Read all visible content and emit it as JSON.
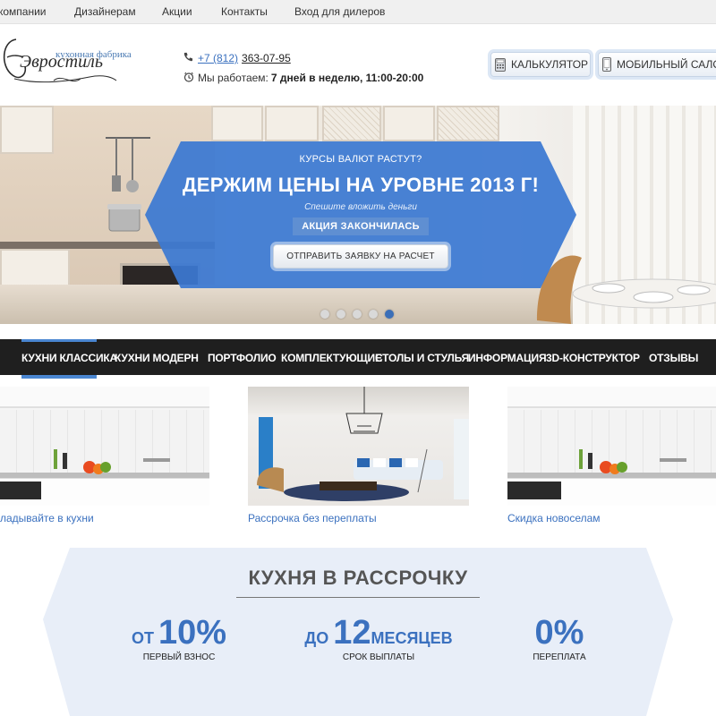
{
  "topnav": {
    "items": [
      "компании",
      "Дизайнерам",
      "Акции",
      "Контакты",
      "Вход для дилеров"
    ]
  },
  "header": {
    "logo_tagline": "кухонная фабрика",
    "logo_name": "Эвростиль",
    "phone_code": "+7 (812)",
    "phone_number": "363-07-95",
    "hours_prefix": "Мы работаем: ",
    "hours_value": "7 дней в неделю, 11:00-20:00",
    "calculator_label": "КАЛЬКУЛЯТОР",
    "mobile_salon_label": "МОБИЛЬНЫЙ САЛОН"
  },
  "hero": {
    "sup": "КУРСЫ ВАЛЮТ РАСТУТ?",
    "title": "ДЕРЖИМ ЦЕНЫ НА УРОВНЕ 2013 Г!",
    "subtitle": "Спешите вложить деньги",
    "ended_label": "АКЦИЯ ЗАКОНЧИЛАСЬ",
    "cta_label": "ОТПРАВИТЬ ЗАЯВКУ НА РАСЧЕТ",
    "slides_count": 5,
    "active_slide": 5,
    "banner_color": "#3b78d2"
  },
  "nav": {
    "items": [
      "КУХНИ КЛАССИКА",
      "КУХНИ МОДЕРН",
      "ПОРТФОЛИО",
      "КОМПЛЕКТУЮЩИЕ",
      "СТОЛЫ И СТУЛЬЯ",
      "ИНФОРМАЦИЯ",
      "3D-КОНСТРУКТОР",
      "ОТЗЫВЫ"
    ],
    "active_index": 0
  },
  "promos": [
    {
      "caption": "ладывайте в кухни"
    },
    {
      "caption": "Рассрочка без переплаты"
    },
    {
      "caption": "Скидка новоселам"
    }
  ],
  "installment": {
    "title": "КУХНЯ В РАССРОЧКУ",
    "stats": [
      {
        "prefix": "ОТ ",
        "value": "10%",
        "suffix": "",
        "caption": "ПЕРВЫЙ ВЗНОС"
      },
      {
        "prefix": "ДО ",
        "value": "12",
        "suffix": "МЕСЯЦЕВ",
        "caption": "СРОК ВЫПЛАТЫ"
      },
      {
        "prefix": "",
        "value": "0%",
        "suffix": "",
        "caption": "ПЕРЕПЛАТА"
      }
    ]
  },
  "colors": {
    "accent": "#3b71bf",
    "nav_bg": "#1f1f1f",
    "installment_bg": "#e8eef8"
  }
}
